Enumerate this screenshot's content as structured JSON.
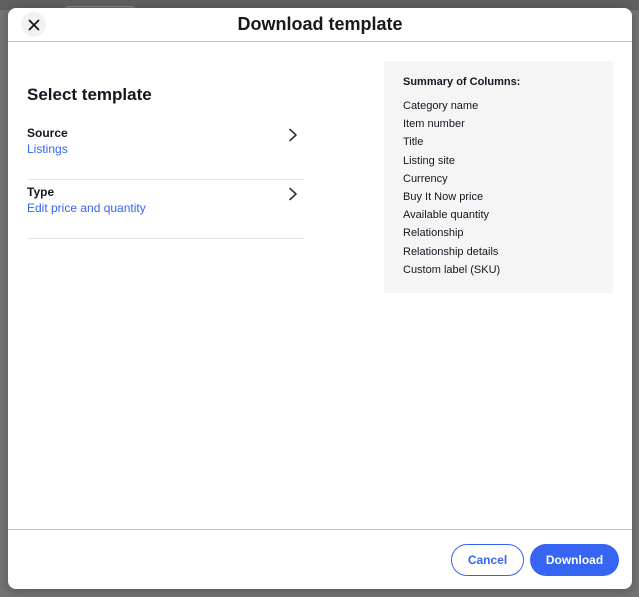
{
  "dialog": {
    "title": "Download template",
    "close_icon": "close-icon"
  },
  "select": {
    "title": "Select template",
    "rows": [
      {
        "label": "Source",
        "value": "Listings",
        "icon": "chevron-right-icon"
      },
      {
        "label": "Type",
        "value": "Edit price and quantity",
        "icon": "chevron-right-icon"
      }
    ]
  },
  "summary": {
    "title": "Summary of Columns:",
    "columns": [
      "Category name",
      "Item number",
      "Title",
      "Listing site",
      "Currency",
      "Buy It Now price",
      "Available quantity",
      "Relationship",
      "Relationship details",
      "Custom label (SKU)"
    ]
  },
  "footer": {
    "cancel_label": "Cancel",
    "download_label": "Download"
  },
  "colors": {
    "accent": "#3665f3",
    "overlay": "#737373",
    "summary_bg": "#f5f5f5"
  }
}
